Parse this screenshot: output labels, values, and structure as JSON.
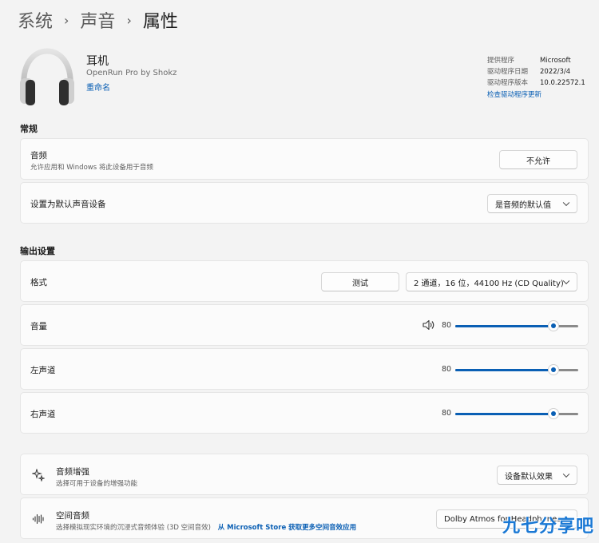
{
  "breadcrumb": {
    "item1": "系统",
    "item2": "声音",
    "current": "属性"
  },
  "device": {
    "name": "耳机",
    "subtitle": "OpenRun Pro by Shokz",
    "rename": "重命名"
  },
  "driver": {
    "provider_key": "提供程序",
    "provider_val": "Microsoft",
    "date_key": "驱动程序日期",
    "date_val": "2022/3/4",
    "version_key": "驱动程序版本",
    "version_val": "10.0.22572.1",
    "update_link": "检查驱动程序更新"
  },
  "general": {
    "title": "常规",
    "audio": {
      "label": "音频",
      "desc": "允许应用和 Windows 将此设备用于音频",
      "button": "不允许"
    },
    "default_device": {
      "label": "设置为默认声音设备",
      "selected": "是音频的默认值"
    }
  },
  "output": {
    "title": "输出设置",
    "format": {
      "label": "格式",
      "test_button": "测试",
      "selected": "2 通道，16 位，44100 Hz (CD Quality)"
    },
    "volume": {
      "label": "音量",
      "value": "80",
      "level": 0.8
    },
    "left": {
      "label": "左声道",
      "value": "80",
      "level": 0.8
    },
    "right": {
      "label": "右声道",
      "value": "80",
      "level": 0.8
    }
  },
  "enhance": {
    "label": "音频增强",
    "desc": "选择可用于设备的增强功能",
    "selected": "设备默认效果"
  },
  "spatial": {
    "label": "空间音频",
    "desc": "选择模拟现实环境的沉浸式音频体验 (3D 空间音效)",
    "link": "从 Microsoft Store 获取更多空间音效应用",
    "selected": "Dolby Atmos for Headphones"
  },
  "watermark": "九七分享吧",
  "colors": {
    "accent": "#0a5fb4",
    "background": "#f3f3f3",
    "card": "#fbfbfb"
  }
}
